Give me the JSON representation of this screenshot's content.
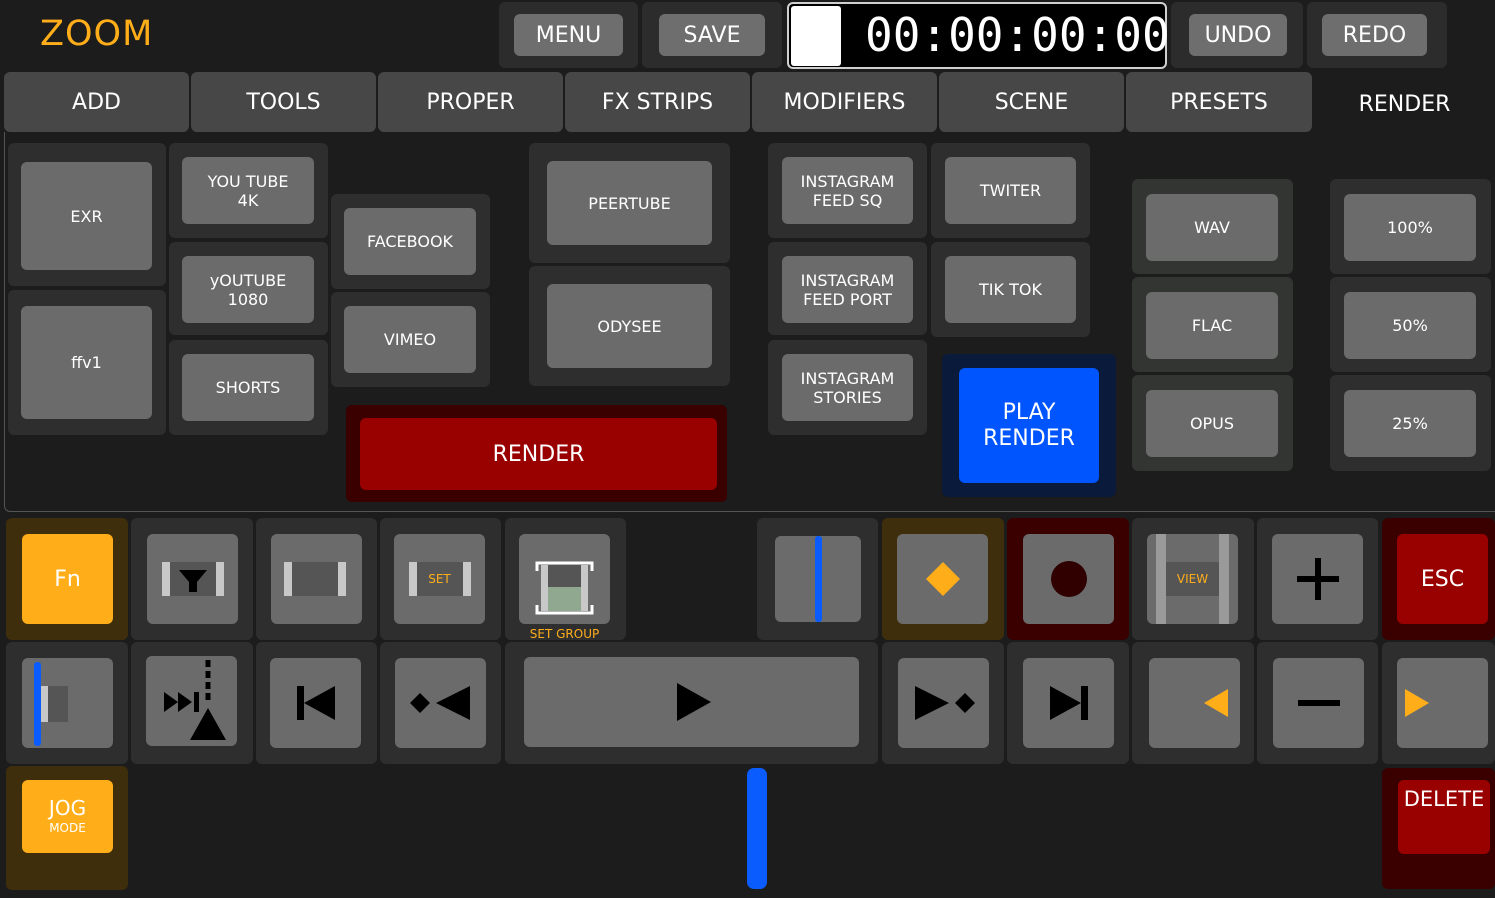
{
  "app": {
    "title": "ZOOM"
  },
  "topbar": {
    "menu_label": "MENU",
    "save_label": "SAVE",
    "timecode": "00:00:00:00",
    "undo_label": "UNDO",
    "redo_label": "REDO"
  },
  "tabs": [
    {
      "label": "ADD"
    },
    {
      "label": "TOOLS"
    },
    {
      "label": "PROPER"
    },
    {
      "label": "FX STRIPS"
    },
    {
      "label": "MODIFIERS"
    },
    {
      "label": "SCENE"
    },
    {
      "label": "PRESETS"
    },
    {
      "label": "RENDER",
      "active": true
    }
  ],
  "render_panel": {
    "formats": [
      "EXR",
      "ffv1"
    ],
    "youtube": [
      "YOU TUBE\n4K",
      "yOUTUBE\n1080",
      "SHORTS"
    ],
    "social": [
      "FACEBOOK",
      "VIMEO"
    ],
    "alt_video": [
      "PEERTUBE",
      "ODYSEE"
    ],
    "instagram": [
      "INSTAGRAM\nFEED SQ",
      "INSTAGRAM\nFEED PORT",
      "INSTAGRAM\nSTORIES"
    ],
    "short_form": [
      "TWITER",
      "TIK TOK"
    ],
    "audio": [
      "WAV",
      "FLAC",
      "OPUS"
    ],
    "scale": [
      "100%",
      "50%",
      "25%"
    ],
    "render_label": "RENDER",
    "play_render_label": "PLAY\nRENDER"
  },
  "controls": {
    "fn_label": "Fn",
    "set_label": "SET",
    "set_group_label": "SET GROUP",
    "view_label": "VIEW",
    "esc_label": "ESC",
    "jog_label": "JOG",
    "jog_mode_label": "MODE",
    "delete_label": "DELETE"
  },
  "colors": {
    "accent_orange": "#FFAE1A",
    "render_red": "#990000",
    "play_blue": "#0055FF",
    "marker_blue": "#0A5CFF"
  },
  "icons": {
    "filter": "filter-icon",
    "clip": "clip-icon",
    "playhead": "playhead-icon",
    "keyframe": "keyframe-diamond-icon",
    "record": "record-icon",
    "plus": "plus-icon",
    "minus": "minus-icon",
    "trim": "trim-icon",
    "split": "split-icon",
    "go_start": "skip-to-start-icon",
    "prev_key": "previous-keyframe-icon",
    "play": "play-icon",
    "next_key": "next-keyframe-icon",
    "go_end": "skip-to-end-icon",
    "left": "arrow-left-icon",
    "right": "arrow-right-icon"
  }
}
